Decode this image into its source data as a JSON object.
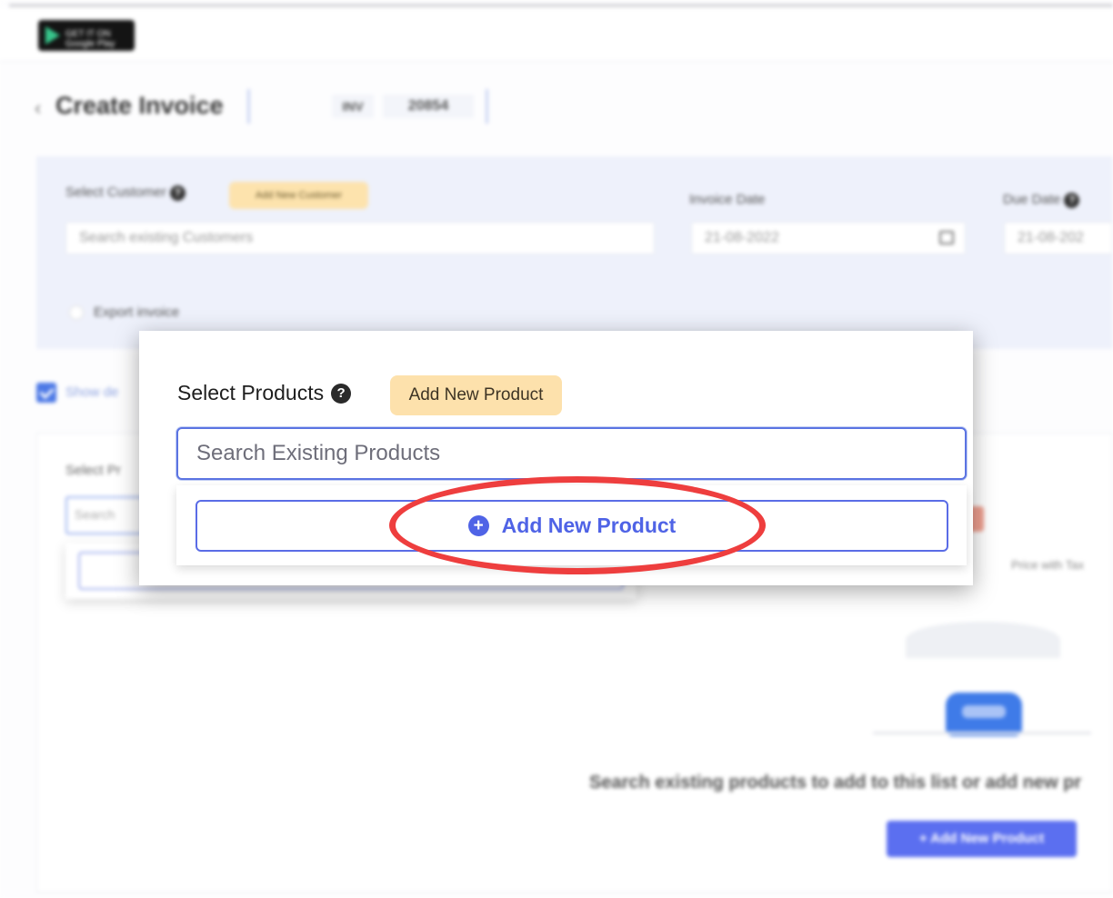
{
  "app": {
    "store_badge_small": "GET IT ON",
    "store_badge_large": "Google Play"
  },
  "header": {
    "back_icon": "chevron-left-icon",
    "title": "Create Invoice",
    "invoice_prefix": "INV",
    "invoice_number": "20854"
  },
  "customer_section": {
    "select_customer_label": "Select Customer",
    "add_customer_button": "Add New Customer",
    "customer_search_placeholder": "Search existing Customers",
    "invoice_date_label": "Invoice Date",
    "invoice_date_value": "21-08-2022",
    "due_date_label": "Due Date",
    "due_date_value": "21-08-202",
    "export_invoice_label": "Export invoice"
  },
  "show_details_label": "Show de",
  "background_products": {
    "select_label": "Select Pr",
    "search_placeholder": "Search",
    "price_with_tax": "Price with Tax",
    "empty_message": "Search existing products to add to this list or add new pr",
    "add_button": "+ Add New Product"
  },
  "popup": {
    "label": "Select Products",
    "help_glyph": "?",
    "add_product_pill": "Add New Product",
    "search_placeholder": "Search Existing Products",
    "dropdown_add_button": "Add New Product",
    "dropdown_add_icon": "plus-circle-icon"
  },
  "colors": {
    "accent": "#4f63e6",
    "pill": "#fde1ac",
    "annotation": "#ee3e3e"
  }
}
